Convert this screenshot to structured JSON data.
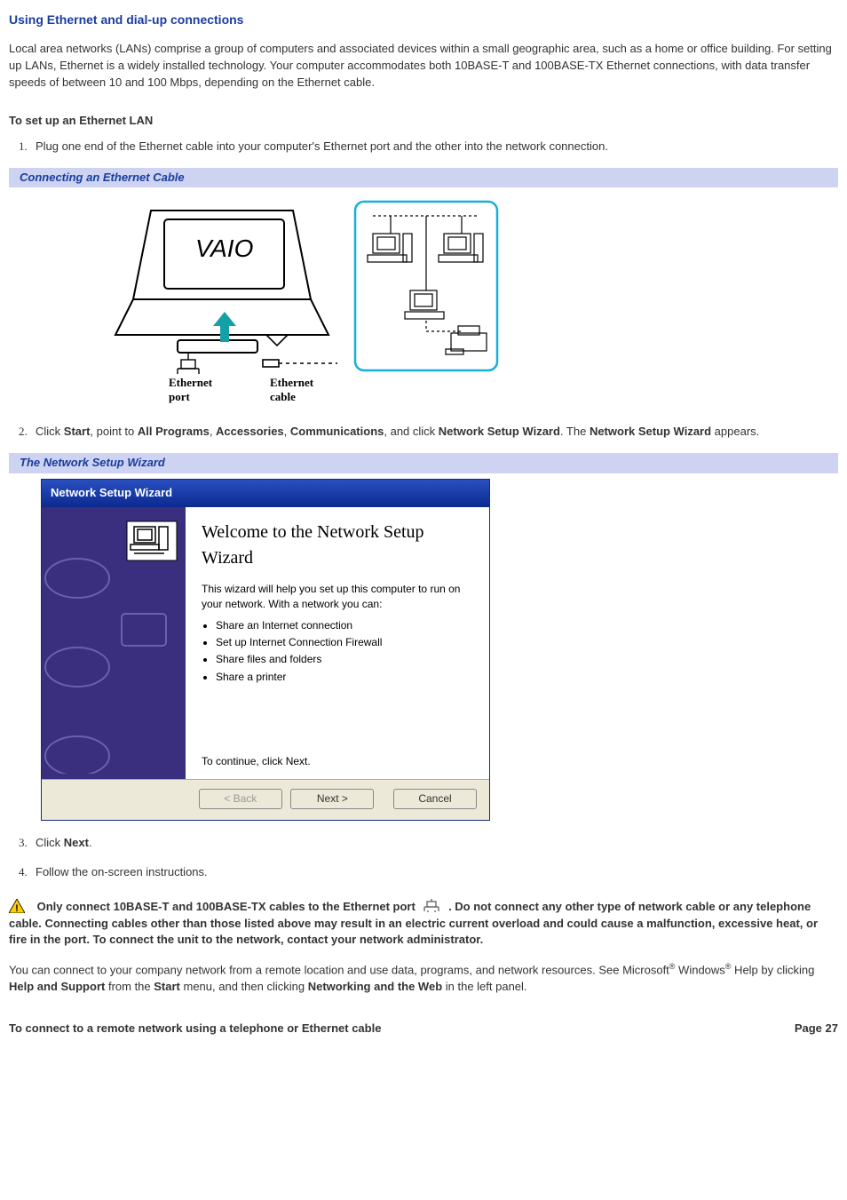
{
  "title": "Using Ethernet and dial-up connections",
  "intro": "Local area networks (LANs) comprise a group of computers and associated devices within a small geographic area, such as a home or office building. For setting up LANs, Ethernet is a widely installed technology. Your computer accommodates both 10BASE-T and 100BASE-TX Ethernet connections, with data transfer speeds of between 10 and 100 Mbps, depending on the Ethernet cable.",
  "sub1": "To set up an Ethernet LAN",
  "steps": {
    "s1": "Plug one end of the Ethernet cable into your computer's Ethernet port and the other into the network connection.",
    "s2_pre": "Click ",
    "s2_start": "Start",
    "s2_a": ", point to ",
    "s2_allprog": "All Programs",
    "s2_b": ", ",
    "s2_acc": "Accessories",
    "s2_c": ", ",
    "s2_comm": "Communications",
    "s2_d": ", and click ",
    "s2_nsw": "Network Setup Wizard",
    "s2_e": ". The ",
    "s2_nsw2": "Network Setup Wizard",
    "s2_f": " appears.",
    "s3_a": "Click ",
    "s3_b": "Next",
    "s3_c": ".",
    "s4": "Follow the on-screen instructions."
  },
  "caption1": "Connecting an Ethernet Cable",
  "caption2": "The Network Setup Wizard",
  "diagram": {
    "port_label": "Ethernet port",
    "cable_label": "Ethernet cable"
  },
  "wizard": {
    "title": "Network Setup Wizard",
    "heading": "Welcome to the Network Setup Wizard",
    "desc": "This wizard will help you set up this computer to run on your network. With a network you can:",
    "items": [
      "Share an Internet connection",
      "Set up Internet Connection Firewall",
      "Share files and folders",
      "Share a printer"
    ],
    "continue": "To continue, click Next.",
    "back": "< Back",
    "next": "Next >",
    "cancel": "Cancel"
  },
  "warning": {
    "a": "Only connect 10BASE-T and 100BASE-TX cables to the Ethernet port ",
    "b": " . Do not connect any other type of network cable or any telephone cable. Connecting cables other than those listed above may result in an electric current overload and could cause a malfunction, excessive heat, or fire in the port. To connect the unit to the network, contact your network administrator."
  },
  "remote": {
    "a": "You can connect to your company network from a remote location and use data, programs, and network resources. See Microsoft",
    "reg1": "®",
    "b": " Windows",
    "reg2": "®",
    "c": " Help by clicking ",
    "help": "Help and Support",
    "d": " from the ",
    "start": "Start",
    "e": " menu, and then clicking ",
    "netweb": "Networking and the Web",
    "f": " in the left panel."
  },
  "footer_left": "To connect to a remote network using a telephone or Ethernet cable",
  "footer_right": "Page 27"
}
